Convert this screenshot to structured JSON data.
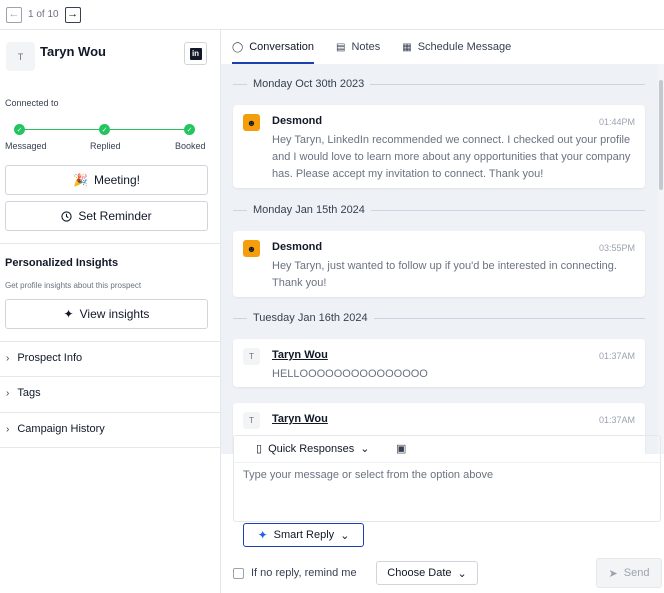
{
  "pager": {
    "label": "1 of 10"
  },
  "prospect": {
    "name": "Taryn Wou",
    "initial": "T",
    "linkedin_glyph": "in"
  },
  "status": {
    "connected_label": "Connected to",
    "stages": [
      "Messaged",
      "Replied",
      "Booked"
    ]
  },
  "actions": {
    "meeting_emoji": "🎉",
    "meeting_label": "Meeting!",
    "reminder_label": "Set Reminder"
  },
  "insights": {
    "title": "Personalized Insights",
    "subtitle": "Get profile insights about this prospect",
    "button_label": "View insights"
  },
  "accordions": [
    "Prospect Info",
    "Tags",
    "Campaign History"
  ],
  "tabs": [
    {
      "label": "Conversation",
      "icon": "chat-bubble-icon",
      "active": true
    },
    {
      "label": "Notes",
      "icon": "notebook-icon",
      "active": false
    },
    {
      "label": "Schedule Message",
      "icon": "calendar-icon",
      "active": false
    }
  ],
  "conversation": {
    "dates": [
      "Monday Oct 30th 2023",
      "Monday Jan 15th 2024",
      "Tuesday Jan 16th 2024"
    ],
    "messages": [
      {
        "sender": "Desmond",
        "avatar": "user-icon",
        "time": "01:44PM",
        "text": "Hey Taryn, LinkedIn recommended we connect. I checked out your profile and I would love to learn more about any opportunities that your company has. Please accept my invitation to connect. Thank you!"
      },
      {
        "sender": "Desmond",
        "avatar": "user-icon",
        "time": "03:55PM",
        "text": "Hey Taryn, just wanted to follow up if you'd be interested in connecting. Thank you!"
      },
      {
        "sender": "Taryn Wou",
        "initial": "T",
        "time": "01:37AM",
        "text": "HELLOOOOOOOOOOOOOOO"
      },
      {
        "sender": "Taryn Wou",
        "initial": "T",
        "time": "01:37AM",
        "text": ""
      }
    ]
  },
  "composer": {
    "quick_responses_label": "Quick Responses",
    "placeholder": "Type your message or select from the option above",
    "smart_reply_label": "Smart Reply"
  },
  "footer": {
    "remind_label": "If no reply, remind me",
    "choose_date_label": "Choose Date",
    "send_label": "Send"
  },
  "colors": {
    "accent": "#1e40af",
    "success": "#22c55e",
    "avatar_orange": "#f59e0b"
  }
}
